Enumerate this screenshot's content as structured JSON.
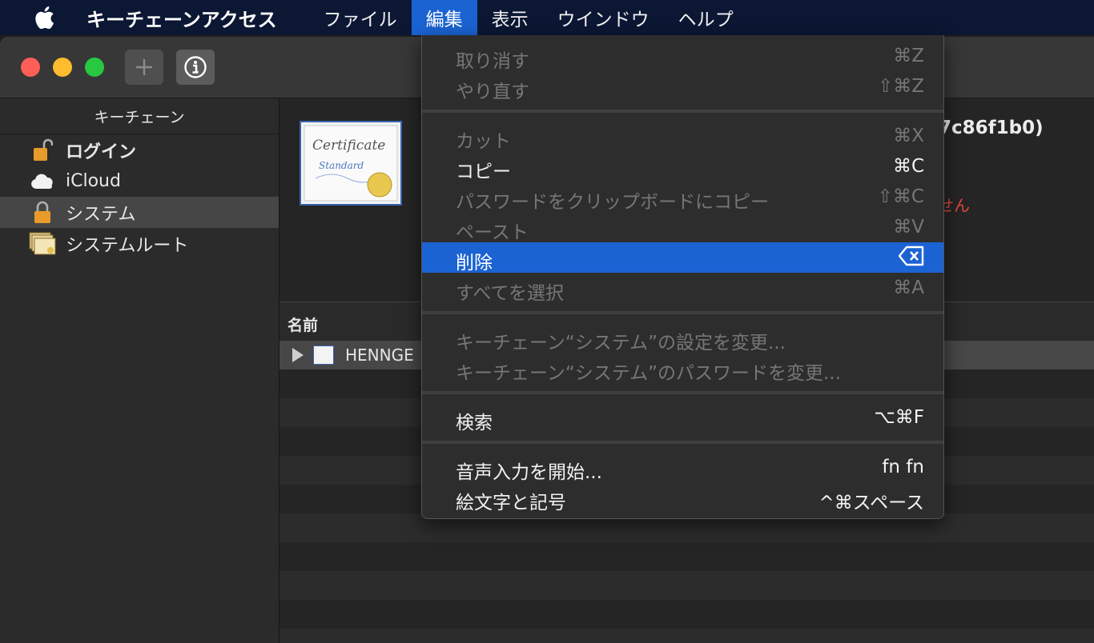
{
  "menubar": {
    "app_name": "キーチェーンアクセス",
    "menus": [
      "ファイル",
      "編集",
      "表示",
      "ウインドウ",
      "ヘルプ"
    ],
    "active_menu": "編集"
  },
  "sidebar": {
    "header": "キーチェーン",
    "items": [
      {
        "label": "ログイン",
        "icon": "unlocked-padlock-icon"
      },
      {
        "label": "iCloud",
        "icon": "cloud-icon"
      },
      {
        "label": "システム",
        "icon": "padlock-icon"
      },
      {
        "label": "システムルート",
        "icon": "certificate-stack-icon"
      }
    ],
    "selected_index": 2
  },
  "detail": {
    "cert_icon_text_1": "Certificate",
    "cert_icon_text_2": "Standard",
    "title_fragment": "7c86f1b0)",
    "warning_fragment": "せん"
  },
  "table": {
    "column_name": "名前",
    "first_row_label": "HENNGE"
  },
  "edit_menu": {
    "groups": [
      [
        {
          "label": "取り消す",
          "shortcut": "⌘Z",
          "enabled": false
        },
        {
          "label": "やり直す",
          "shortcut": "⇧⌘Z",
          "enabled": false
        }
      ],
      [
        {
          "label": "カット",
          "shortcut": "⌘X",
          "enabled": false
        },
        {
          "label": "コピー",
          "shortcut": "⌘C",
          "enabled": true
        },
        {
          "label": "パスワードをクリップボードにコピー",
          "shortcut": "⇧⌘C",
          "enabled": false
        },
        {
          "label": "ペースト",
          "shortcut": "⌘V",
          "enabled": false
        },
        {
          "label": "削除",
          "shortcut": "⌫",
          "enabled": true,
          "highlighted": true
        },
        {
          "label": "すべてを選択",
          "shortcut": "⌘A",
          "enabled": false
        }
      ],
      [
        {
          "label": "キーチェーン“システム”の設定を変更...",
          "shortcut": "",
          "enabled": false
        },
        {
          "label": "キーチェーン“システム”のパスワードを変更...",
          "shortcut": "",
          "enabled": false
        }
      ],
      [
        {
          "label": "検索",
          "shortcut": "⌥⌘F",
          "enabled": true
        }
      ],
      [
        {
          "label": "音声入力を開始...",
          "shortcut": "fn fn",
          "enabled": true
        },
        {
          "label": "絵文字と記号",
          "shortcut": "^⌘スペース",
          "enabled": true
        }
      ]
    ]
  },
  "colors": {
    "menubar_bg": "#0b1733",
    "highlight": "#1b63d3",
    "warning": "#e5453a"
  }
}
